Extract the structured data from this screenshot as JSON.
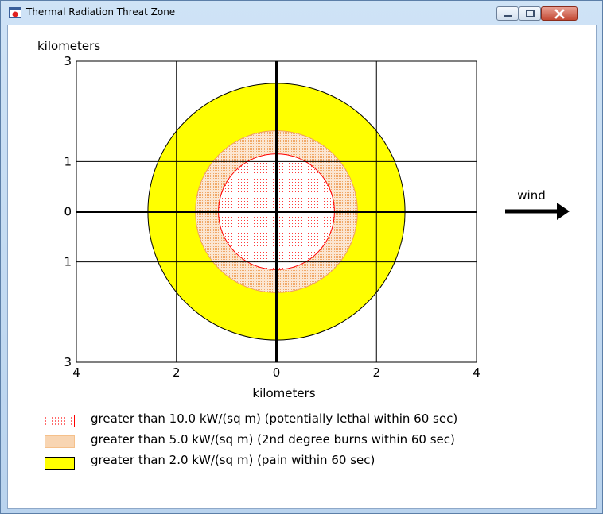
{
  "window": {
    "title": "Thermal Radiation Threat Zone"
  },
  "plot": {
    "y_axis_unit": "kilometers",
    "x_axis_unit": "kilometers",
    "y_ticks": [
      "3",
      "1",
      "0",
      "1",
      "3"
    ],
    "x_ticks": [
      "4",
      "2",
      "0",
      "2",
      "4"
    ],
    "wind_label": "wind"
  },
  "legend": [
    {
      "label": "greater than 10.0 kW/(sq m) (potentially lethal within 60 sec)",
      "color": "#ff0000"
    },
    {
      "label": "greater than 5.0 kW/(sq m) (2nd degree burns within 60 sec)",
      "color": "#f5c08a"
    },
    {
      "label": "greater than 2.0 kW/(sq m) (pain within 60 sec)",
      "color": "#ffff00"
    }
  ],
  "chart_data": {
    "type": "scatter",
    "xlabel": "kilometers",
    "ylabel": "kilometers",
    "xlim": [
      -4,
      4
    ],
    "ylim": [
      -3,
      3
    ],
    "zones": [
      {
        "threshold_kw_sq_m": 10.0,
        "radius_km": 1.16,
        "fill": "#ff0000"
      },
      {
        "threshold_kw_sq_m": 5.0,
        "radius_km": 1.62,
        "fill": "#f5c08a"
      },
      {
        "threshold_kw_sq_m": 2.0,
        "radius_km": 2.57,
        "fill": "#ffff00"
      }
    ]
  }
}
